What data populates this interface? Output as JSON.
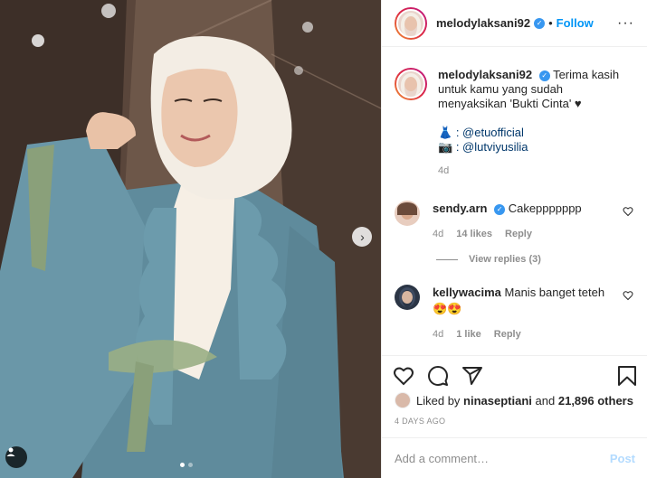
{
  "post": {
    "username": "melodylaksani92",
    "follow_label": "Follow",
    "bullet": "•",
    "more_label": "···",
    "carousel": {
      "count": 2,
      "active": 0
    }
  },
  "caption": {
    "username": "melodylaksani92",
    "text": "Terima kasih untuk kamu yang sudah menyaksikan 'Bukti Cinta' ♥",
    "credit1_emoji": "👗",
    "credit1": ": @etuofficial",
    "credit2_emoji": "📷",
    "credit2": ": @lutviyusilia",
    "time": "4d"
  },
  "comments": [
    {
      "username": "sendy.arn",
      "verified": true,
      "text": "Cakeppppppp",
      "time": "4d",
      "likes": "14 likes",
      "reply": "Reply",
      "view_replies": "View replies (3)"
    },
    {
      "username": "kellywacima",
      "verified": false,
      "text": "Manis banget teteh 😍😍",
      "time": "4d",
      "likes": "1 like",
      "reply": "Reply"
    }
  ],
  "actions": {
    "like_icon": "heart-icon",
    "comment_icon": "comment-icon",
    "share_icon": "share-icon",
    "save_icon": "bookmark-icon"
  },
  "likes": {
    "prefix": "Liked by",
    "user": "ninaseptiani",
    "and": "and",
    "count": "21,896 others"
  },
  "date": "4 DAYS AGO",
  "add_comment": {
    "placeholder": "Add a comment…",
    "post_label": "Post"
  }
}
